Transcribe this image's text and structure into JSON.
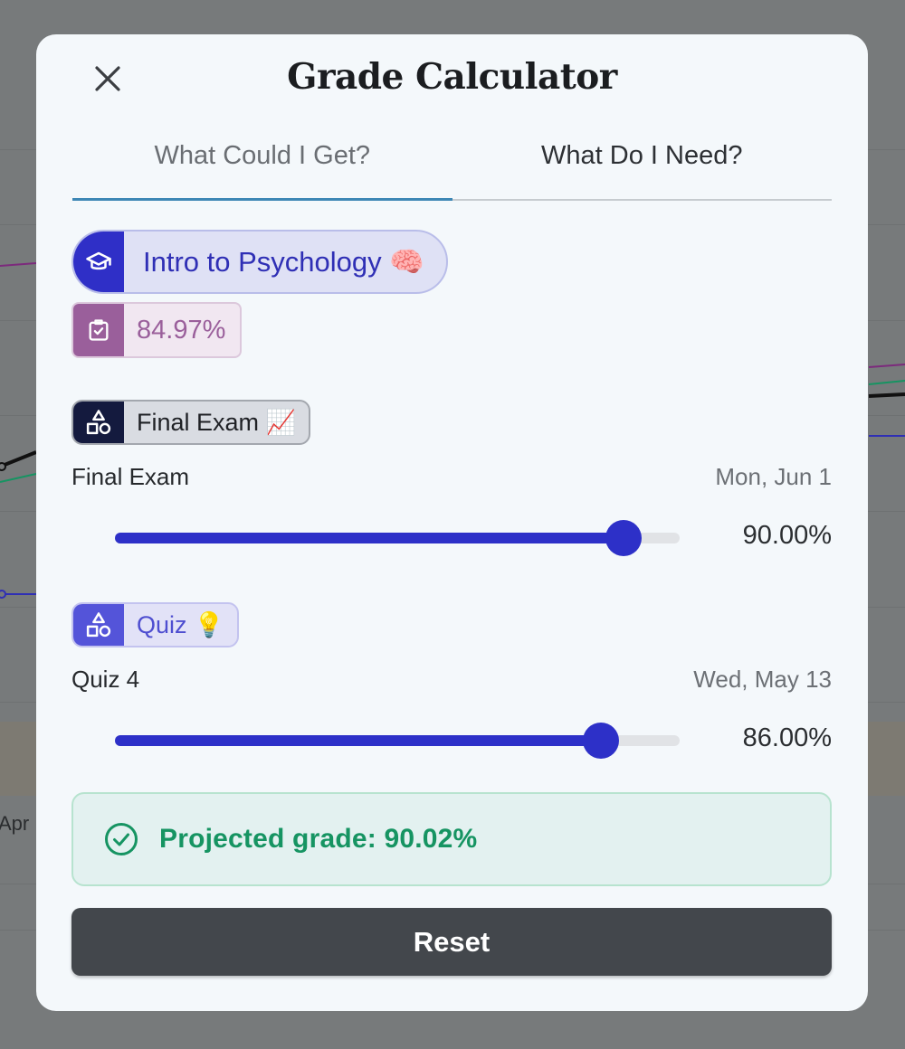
{
  "background": {
    "axis_label": "Apr"
  },
  "modal": {
    "title": "Grade Calculator",
    "tabs": [
      {
        "label": "What Could I Get?",
        "active": true
      },
      {
        "label": "What Do I Need?",
        "active": false
      }
    ],
    "course": {
      "name": "Intro to Psychology 🧠",
      "icon": "graduation-cap-icon",
      "color": "#2f2fc7"
    },
    "current_grade": {
      "value": "84.97%",
      "icon": "clipboard-check-icon",
      "color": "#9a5f9b"
    },
    "categories": [
      {
        "label": "Final Exam 📈",
        "icon": "shapes-icon",
        "item": {
          "name": "Final Exam",
          "date": "Mon, Jun 1",
          "percent_label": "90.00%",
          "slider_value": 90
        }
      },
      {
        "label": "Quiz 💡",
        "icon": "shapes-icon",
        "item": {
          "name": "Quiz 4",
          "date": "Wed, May 13",
          "percent_label": "86.00%",
          "slider_value": 86
        }
      }
    ],
    "projected": {
      "text": "Projected grade: 90.02%",
      "icon": "check-circle-icon",
      "color": "#169462"
    },
    "reset_label": "Reset",
    "accent": "#2d30c8"
  }
}
